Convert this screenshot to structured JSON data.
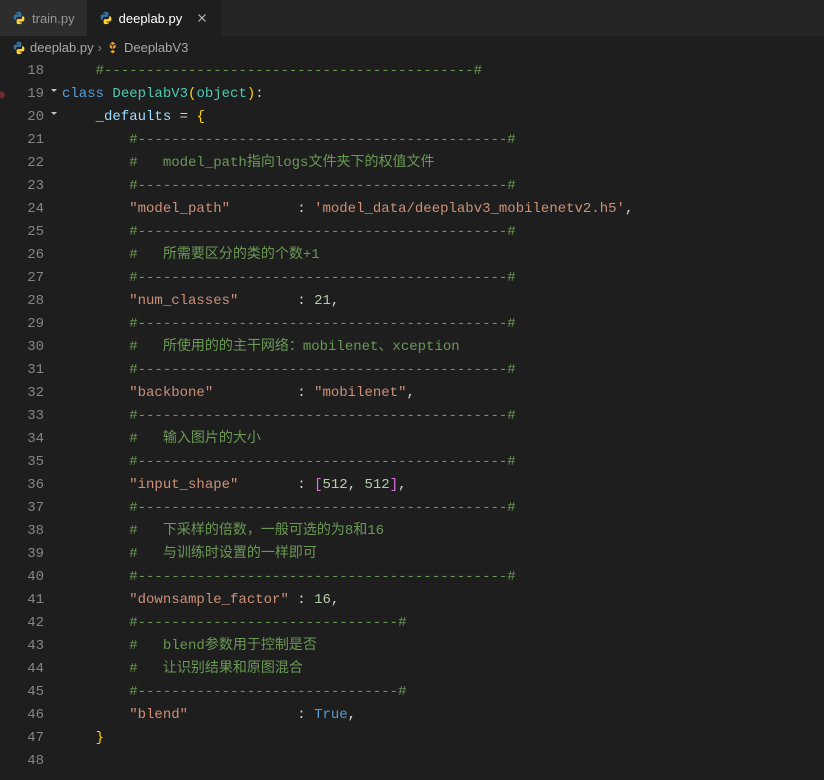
{
  "tabs": [
    {
      "label": "train.py",
      "active": false
    },
    {
      "label": "deeplab.py",
      "active": true
    }
  ],
  "breadcrumb": {
    "file": "deeplab.py",
    "symbol": "DeeplabV3"
  },
  "gutter": {
    "start": 18,
    "end": 48,
    "breakpoint_line": 19,
    "fold_lines": [
      19,
      20
    ]
  },
  "code": {
    "sep_long": "#--------------------------------------------#",
    "sep_short": "#-------------------------------#",
    "class_kw": "class",
    "class_name": "DeeplabV3",
    "class_base": "object",
    "defaults_name": "_defaults",
    "entries": {
      "model_path": {
        "key": "\"model_path\"",
        "val": "'model_data/deeplabv3_mobilenetv2.h5'",
        "comment": "#   model_path指向logs文件夹下的权值文件"
      },
      "num_classes": {
        "key": "\"num_classes\"",
        "val": "21",
        "comment": "#   所需要区分的类的个数+1"
      },
      "backbone": {
        "key": "\"backbone\"",
        "val": "\"mobilenet\"",
        "comment": "#   所使用的的主干网络：mobilenet、xception"
      },
      "input_shape": {
        "key": "\"input_shape\"",
        "val1": "512",
        "val2": "512",
        "comment": "#   输入图片的大小"
      },
      "downsample_factor": {
        "key": "\"downsample_factor\"",
        "val": "16",
        "comment1": "#   下采样的倍数，一般可选的为8和16",
        "comment2": "#   与训练时设置的一样即可"
      },
      "blend": {
        "key": "\"blend\"",
        "val": "True",
        "comment1": "#   blend参数用于控制是否",
        "comment2": "#   让识别结果和原图混合"
      }
    }
  }
}
